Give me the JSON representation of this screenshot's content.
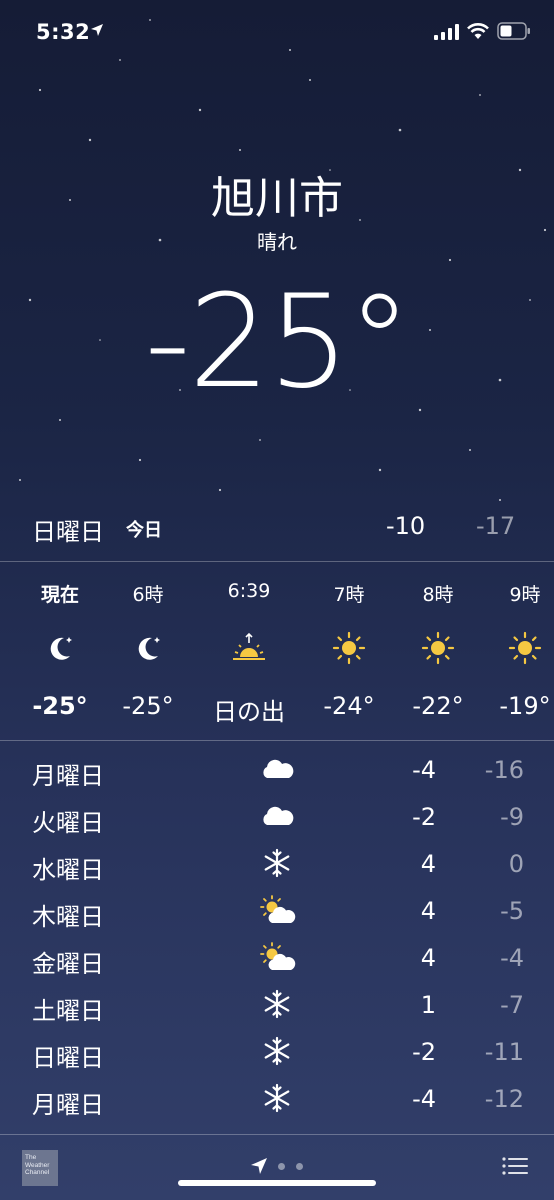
{
  "status_bar": {
    "time": "5:32"
  },
  "location": {
    "city": "旭川市",
    "condition": "晴れ",
    "temperature": "-25°"
  },
  "today": {
    "day": "日曜日",
    "tag": "今日",
    "high": "-10",
    "low": "-17"
  },
  "hourly": [
    {
      "time": "現在",
      "icon": "moon-stars-icon",
      "temp": "-25°"
    },
    {
      "time": "6時",
      "icon": "moon-stars-icon",
      "temp": "-25°"
    },
    {
      "time": "6:39",
      "icon": "sunrise-icon",
      "temp": "日の出"
    },
    {
      "time": "7時",
      "icon": "sun-icon",
      "temp": "-24°"
    },
    {
      "time": "8時",
      "icon": "sun-icon",
      "temp": "-22°"
    },
    {
      "time": "9時",
      "icon": "sun-icon",
      "temp": "-19°"
    }
  ],
  "daily": [
    {
      "day": "月曜日",
      "icon": "cloud-icon",
      "high": "-4",
      "low": "-16"
    },
    {
      "day": "火曜日",
      "icon": "cloud-icon",
      "high": "-2",
      "low": "-9"
    },
    {
      "day": "水曜日",
      "icon": "snowflake-icon",
      "high": "4",
      "low": "0"
    },
    {
      "day": "木曜日",
      "icon": "partly-cloudy-icon",
      "high": "4",
      "low": "-5"
    },
    {
      "day": "金曜日",
      "icon": "partly-cloudy-icon",
      "high": "4",
      "low": "-4"
    },
    {
      "day": "土曜日",
      "icon": "snowflake-icon",
      "high": "1",
      "low": "-7"
    },
    {
      "day": "日曜日",
      "icon": "snowflake-icon",
      "high": "-2",
      "low": "-11"
    },
    {
      "day": "月曜日",
      "icon": "snowflake-icon",
      "high": "-4",
      "low": "-12"
    }
  ],
  "footer": {
    "logo_text": "The Weather Channel"
  },
  "colors": {
    "sun": "#f5c842",
    "background_top": "#151c36",
    "background_bottom": "#323f6a"
  }
}
